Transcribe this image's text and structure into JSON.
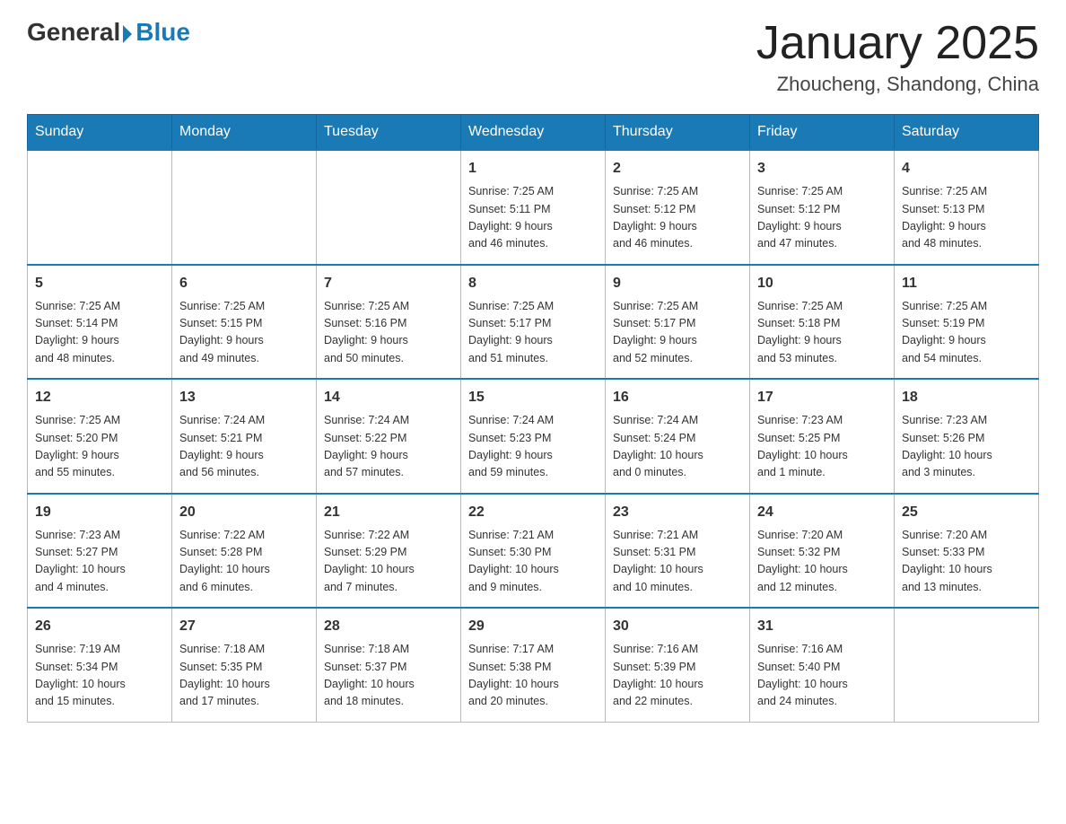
{
  "header": {
    "logo_general": "General",
    "logo_blue": "Blue",
    "month_title": "January 2025",
    "location": "Zhoucheng, Shandong, China"
  },
  "weekdays": [
    "Sunday",
    "Monday",
    "Tuesday",
    "Wednesday",
    "Thursday",
    "Friday",
    "Saturday"
  ],
  "weeks": [
    [
      {
        "day": "",
        "info": ""
      },
      {
        "day": "",
        "info": ""
      },
      {
        "day": "",
        "info": ""
      },
      {
        "day": "1",
        "info": "Sunrise: 7:25 AM\nSunset: 5:11 PM\nDaylight: 9 hours\nand 46 minutes."
      },
      {
        "day": "2",
        "info": "Sunrise: 7:25 AM\nSunset: 5:12 PM\nDaylight: 9 hours\nand 46 minutes."
      },
      {
        "day": "3",
        "info": "Sunrise: 7:25 AM\nSunset: 5:12 PM\nDaylight: 9 hours\nand 47 minutes."
      },
      {
        "day": "4",
        "info": "Sunrise: 7:25 AM\nSunset: 5:13 PM\nDaylight: 9 hours\nand 48 minutes."
      }
    ],
    [
      {
        "day": "5",
        "info": "Sunrise: 7:25 AM\nSunset: 5:14 PM\nDaylight: 9 hours\nand 48 minutes."
      },
      {
        "day": "6",
        "info": "Sunrise: 7:25 AM\nSunset: 5:15 PM\nDaylight: 9 hours\nand 49 minutes."
      },
      {
        "day": "7",
        "info": "Sunrise: 7:25 AM\nSunset: 5:16 PM\nDaylight: 9 hours\nand 50 minutes."
      },
      {
        "day": "8",
        "info": "Sunrise: 7:25 AM\nSunset: 5:17 PM\nDaylight: 9 hours\nand 51 minutes."
      },
      {
        "day": "9",
        "info": "Sunrise: 7:25 AM\nSunset: 5:17 PM\nDaylight: 9 hours\nand 52 minutes."
      },
      {
        "day": "10",
        "info": "Sunrise: 7:25 AM\nSunset: 5:18 PM\nDaylight: 9 hours\nand 53 minutes."
      },
      {
        "day": "11",
        "info": "Sunrise: 7:25 AM\nSunset: 5:19 PM\nDaylight: 9 hours\nand 54 minutes."
      }
    ],
    [
      {
        "day": "12",
        "info": "Sunrise: 7:25 AM\nSunset: 5:20 PM\nDaylight: 9 hours\nand 55 minutes."
      },
      {
        "day": "13",
        "info": "Sunrise: 7:24 AM\nSunset: 5:21 PM\nDaylight: 9 hours\nand 56 minutes."
      },
      {
        "day": "14",
        "info": "Sunrise: 7:24 AM\nSunset: 5:22 PM\nDaylight: 9 hours\nand 57 minutes."
      },
      {
        "day": "15",
        "info": "Sunrise: 7:24 AM\nSunset: 5:23 PM\nDaylight: 9 hours\nand 59 minutes."
      },
      {
        "day": "16",
        "info": "Sunrise: 7:24 AM\nSunset: 5:24 PM\nDaylight: 10 hours\nand 0 minutes."
      },
      {
        "day": "17",
        "info": "Sunrise: 7:23 AM\nSunset: 5:25 PM\nDaylight: 10 hours\nand 1 minute."
      },
      {
        "day": "18",
        "info": "Sunrise: 7:23 AM\nSunset: 5:26 PM\nDaylight: 10 hours\nand 3 minutes."
      }
    ],
    [
      {
        "day": "19",
        "info": "Sunrise: 7:23 AM\nSunset: 5:27 PM\nDaylight: 10 hours\nand 4 minutes."
      },
      {
        "day": "20",
        "info": "Sunrise: 7:22 AM\nSunset: 5:28 PM\nDaylight: 10 hours\nand 6 minutes."
      },
      {
        "day": "21",
        "info": "Sunrise: 7:22 AM\nSunset: 5:29 PM\nDaylight: 10 hours\nand 7 minutes."
      },
      {
        "day": "22",
        "info": "Sunrise: 7:21 AM\nSunset: 5:30 PM\nDaylight: 10 hours\nand 9 minutes."
      },
      {
        "day": "23",
        "info": "Sunrise: 7:21 AM\nSunset: 5:31 PM\nDaylight: 10 hours\nand 10 minutes."
      },
      {
        "day": "24",
        "info": "Sunrise: 7:20 AM\nSunset: 5:32 PM\nDaylight: 10 hours\nand 12 minutes."
      },
      {
        "day": "25",
        "info": "Sunrise: 7:20 AM\nSunset: 5:33 PM\nDaylight: 10 hours\nand 13 minutes."
      }
    ],
    [
      {
        "day": "26",
        "info": "Sunrise: 7:19 AM\nSunset: 5:34 PM\nDaylight: 10 hours\nand 15 minutes."
      },
      {
        "day": "27",
        "info": "Sunrise: 7:18 AM\nSunset: 5:35 PM\nDaylight: 10 hours\nand 17 minutes."
      },
      {
        "day": "28",
        "info": "Sunrise: 7:18 AM\nSunset: 5:37 PM\nDaylight: 10 hours\nand 18 minutes."
      },
      {
        "day": "29",
        "info": "Sunrise: 7:17 AM\nSunset: 5:38 PM\nDaylight: 10 hours\nand 20 minutes."
      },
      {
        "day": "30",
        "info": "Sunrise: 7:16 AM\nSunset: 5:39 PM\nDaylight: 10 hours\nand 22 minutes."
      },
      {
        "day": "31",
        "info": "Sunrise: 7:16 AM\nSunset: 5:40 PM\nDaylight: 10 hours\nand 24 minutes."
      },
      {
        "day": "",
        "info": ""
      }
    ]
  ]
}
